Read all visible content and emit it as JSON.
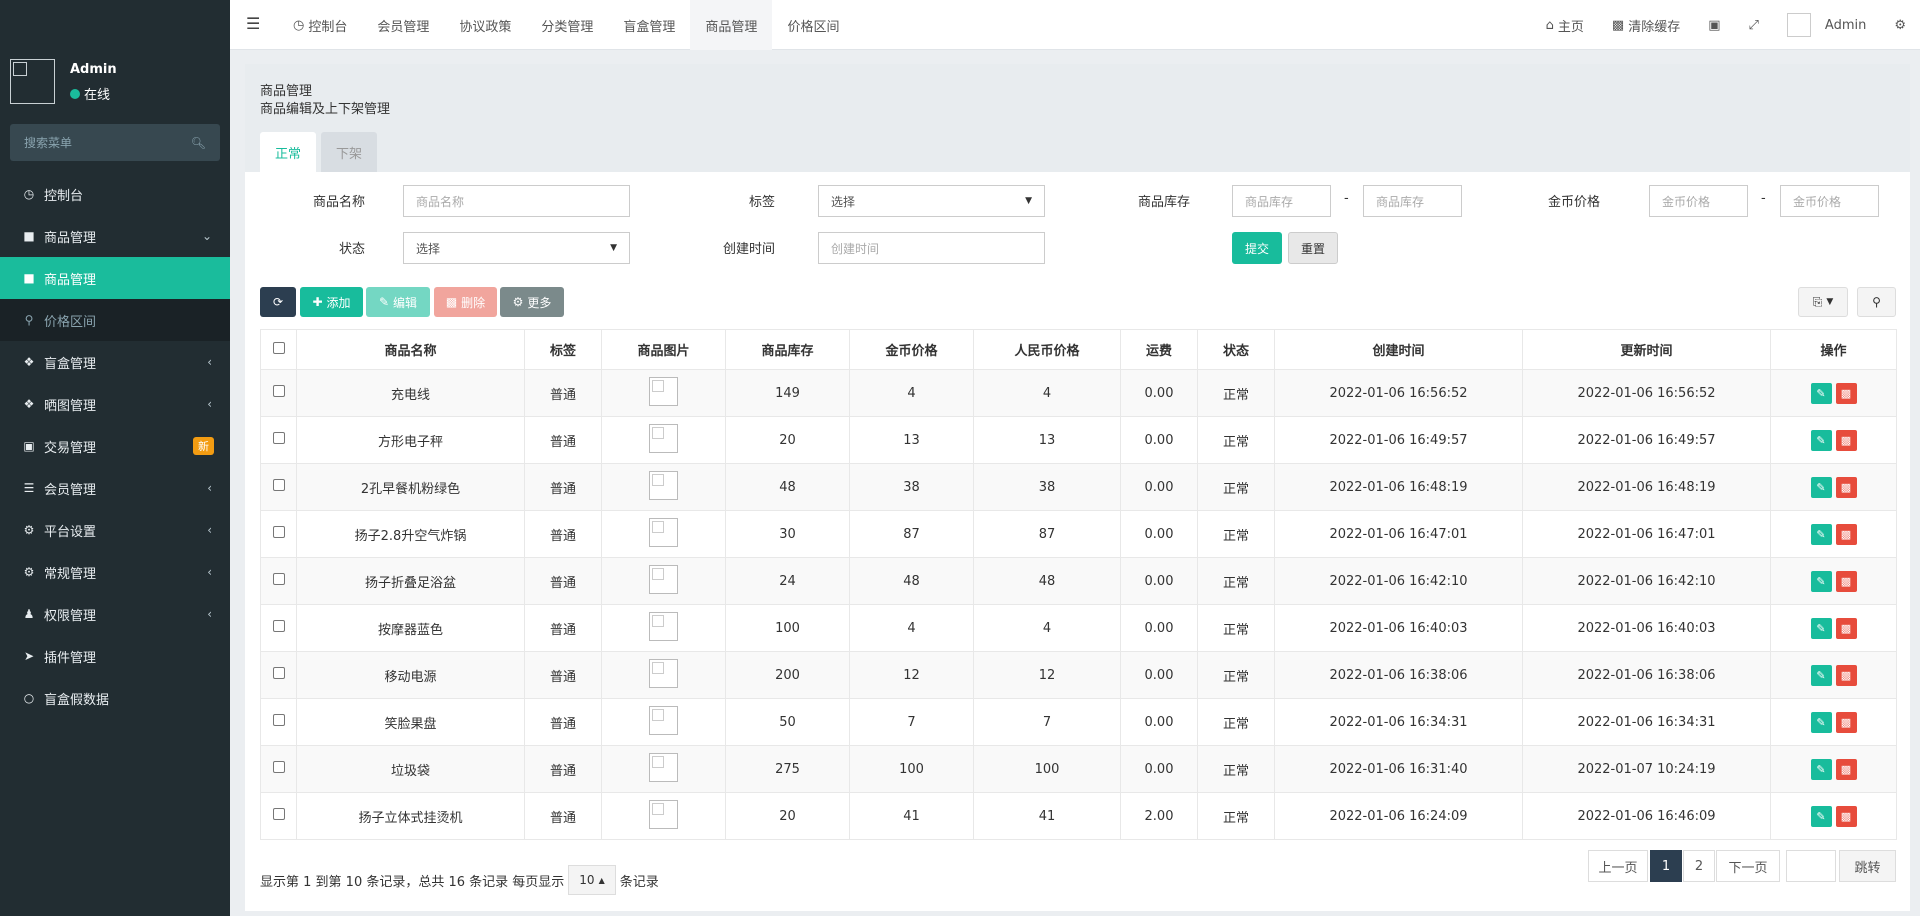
{
  "user": {
    "name": "Admin",
    "status": "在线"
  },
  "sidebar": {
    "search_placeholder": "搜索菜单",
    "items": [
      {
        "label": "控制台",
        "icon": "dashboard-icon"
      },
      {
        "label": "商品管理",
        "icon": "shopping-bag-icon"
      },
      {
        "label": "商品管理",
        "icon": "shopping-bag-icon"
      },
      {
        "label": "价格区间",
        "icon": "search-icon"
      },
      {
        "label": "盲盒管理",
        "icon": "dropbox-icon"
      },
      {
        "label": "晒图管理",
        "icon": "dropbox-icon"
      },
      {
        "label": "交易管理",
        "icon": "cart-icon",
        "badge": "新"
      },
      {
        "label": "会员管理",
        "icon": "list-icon"
      },
      {
        "label": "平台设置",
        "icon": "cogs-icon"
      },
      {
        "label": "常规管理",
        "icon": "cogs-icon"
      },
      {
        "label": "权限管理",
        "icon": "group-icon"
      },
      {
        "label": "插件管理",
        "icon": "rocket-icon"
      },
      {
        "label": "盲盒假数据",
        "icon": "circle-icon"
      }
    ]
  },
  "topnav": {
    "tabs": [
      "控制台",
      "会员管理",
      "协议政策",
      "分类管理",
      "盲盒管理",
      "商品管理",
      "价格区间"
    ],
    "home": "主页",
    "clear_cache": "清除缓存",
    "admin": "Admin"
  },
  "page": {
    "title": "商品管理",
    "subtitle": "商品编辑及上下架管理",
    "tabs": [
      "正常",
      "下架"
    ]
  },
  "filters": {
    "name_label": "商品名称",
    "name_placeholder": "商品名称",
    "tag_label": "标签",
    "tag_value": "选择",
    "stock_label": "商品库存",
    "stock_placeholder": "商品库存",
    "price_label": "金币价格",
    "price_placeholder": "金币价格",
    "status_label": "状态",
    "status_value": "选择",
    "created_label": "创建时间",
    "created_placeholder": "创建时间",
    "dash": "-",
    "submit": "提交",
    "reset": "重置"
  },
  "toolbar": {
    "add": "添加",
    "edit": "编辑",
    "delete": "删除",
    "more": "更多"
  },
  "table": {
    "headers": [
      "商品名称",
      "标签",
      "商品图片",
      "商品库存",
      "金币价格",
      "人民币价格",
      "运费",
      "状态",
      "创建时间",
      "更新时间",
      "操作"
    ],
    "rows": [
      {
        "name": "充电线",
        "tag": "普通",
        "stock": "149",
        "gold": "4",
        "rmb": "4",
        "freight": "0.00",
        "status": "正常",
        "created": "2022-01-06 16:56:52",
        "updated": "2022-01-06 16:56:52"
      },
      {
        "name": "方形电子秤",
        "tag": "普通",
        "stock": "20",
        "gold": "13",
        "rmb": "13",
        "freight": "0.00",
        "status": "正常",
        "created": "2022-01-06 16:49:57",
        "updated": "2022-01-06 16:49:57"
      },
      {
        "name": "2孔早餐机粉绿色",
        "tag": "普通",
        "stock": "48",
        "gold": "38",
        "rmb": "38",
        "freight": "0.00",
        "status": "正常",
        "created": "2022-01-06 16:48:19",
        "updated": "2022-01-06 16:48:19"
      },
      {
        "name": "扬子2.8升空气炸锅",
        "tag": "普通",
        "stock": "30",
        "gold": "87",
        "rmb": "87",
        "freight": "0.00",
        "status": "正常",
        "created": "2022-01-06 16:47:01",
        "updated": "2022-01-06 16:47:01"
      },
      {
        "name": "扬子折叠足浴盆",
        "tag": "普通",
        "stock": "24",
        "gold": "48",
        "rmb": "48",
        "freight": "0.00",
        "status": "正常",
        "created": "2022-01-06 16:42:10",
        "updated": "2022-01-06 16:42:10"
      },
      {
        "name": "按摩器蓝色",
        "tag": "普通",
        "stock": "100",
        "gold": "4",
        "rmb": "4",
        "freight": "0.00",
        "status": "正常",
        "created": "2022-01-06 16:40:03",
        "updated": "2022-01-06 16:40:03"
      },
      {
        "name": "移动电源",
        "tag": "普通",
        "stock": "200",
        "gold": "12",
        "rmb": "12",
        "freight": "0.00",
        "status": "正常",
        "created": "2022-01-06 16:38:06",
        "updated": "2022-01-06 16:38:06"
      },
      {
        "name": "笑脸果盘",
        "tag": "普通",
        "stock": "50",
        "gold": "7",
        "rmb": "7",
        "freight": "0.00",
        "status": "正常",
        "created": "2022-01-06 16:34:31",
        "updated": "2022-01-06 16:34:31"
      },
      {
        "name": "垃圾袋",
        "tag": "普通",
        "stock": "275",
        "gold": "100",
        "rmb": "100",
        "freight": "0.00",
        "status": "正常",
        "created": "2022-01-06 16:31:40",
        "updated": "2022-01-07 10:24:19"
      },
      {
        "name": "扬子立体式挂烫机",
        "tag": "普通",
        "stock": "20",
        "gold": "41",
        "rmb": "41",
        "freight": "2.00",
        "status": "正常",
        "created": "2022-01-06 16:24:09",
        "updated": "2022-01-06 16:46:09"
      }
    ]
  },
  "pagination": {
    "info_prefix": "显示第 1 到第 10 条记录，总共 16 条记录 每页显示",
    "page_size": "10",
    "info_suffix": "条记录",
    "prev": "上一页",
    "page1": "1",
    "page2": "2",
    "next": "下一页",
    "jump": "跳转"
  },
  "colors": {
    "accent": "#18bc9c",
    "sidebar": "#222d32",
    "danger": "#e74c3c",
    "dark": "#2c3e50"
  }
}
